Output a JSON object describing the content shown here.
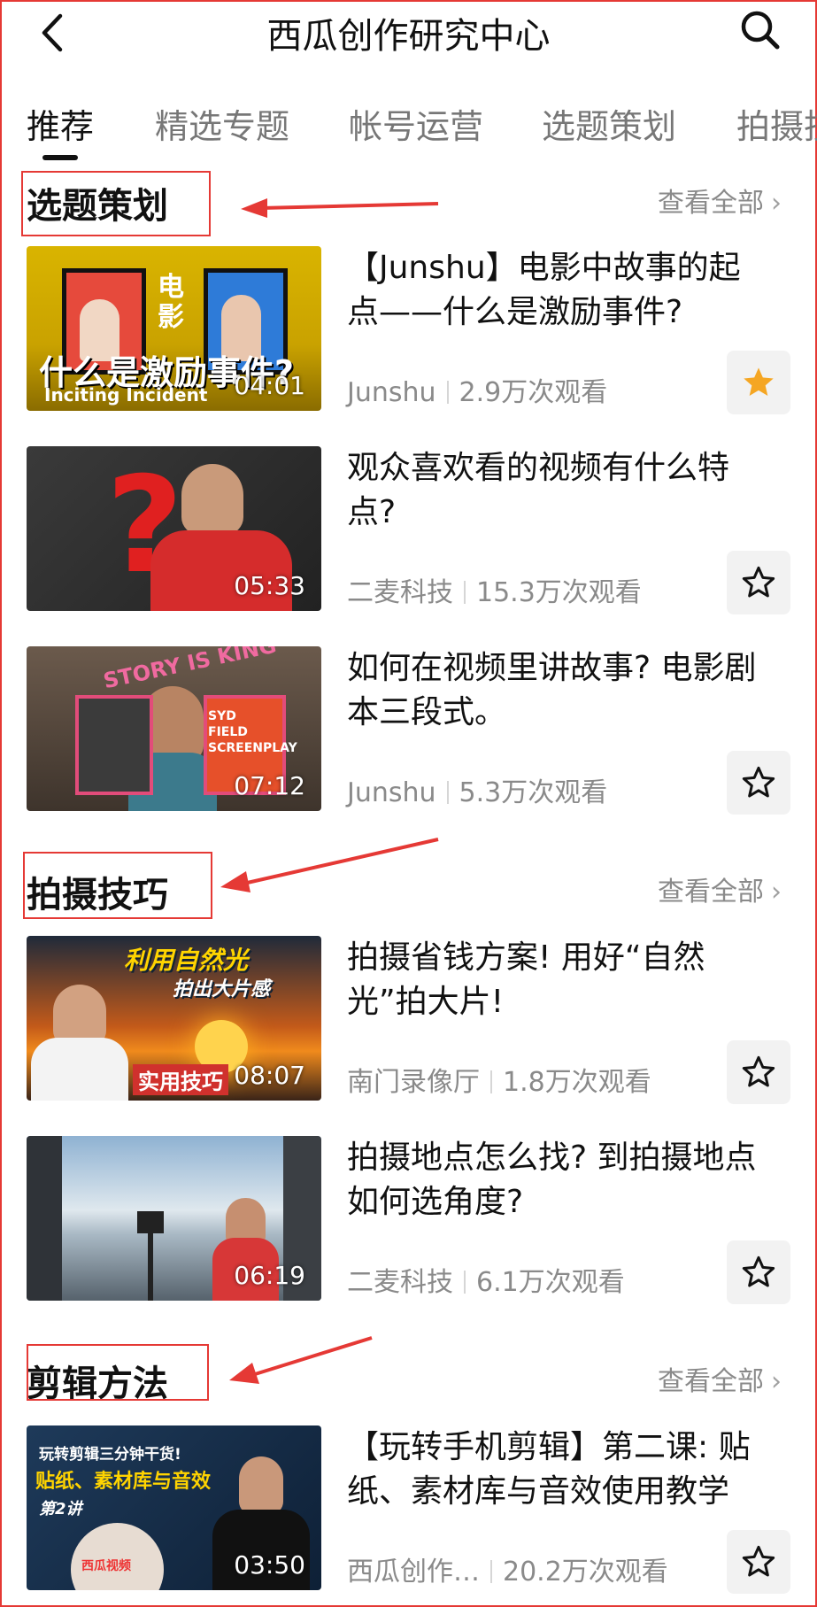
{
  "header": {
    "title": "西瓜创作研究中心",
    "back_icon": "chevron-left-icon",
    "search_icon": "search-icon"
  },
  "tabs": [
    {
      "label": "推荐",
      "active": true
    },
    {
      "label": "精选专题",
      "active": false
    },
    {
      "label": "帐号运营",
      "active": false
    },
    {
      "label": "选题策划",
      "active": false
    },
    {
      "label": "拍摄技巧",
      "active": false
    }
  ],
  "sections": [
    {
      "title": "选题策划",
      "see_all": "查看全部",
      "videos": [
        {
          "title": "【Junshu】电影中故事的起点——什么是激励事件?",
          "author": "Junshu",
          "views": "2.9万次观看",
          "duration": "04:01",
          "favorited": true,
          "thumb_text": "什么是激励事件?",
          "thumb_sub": "Inciting Incident",
          "thumb_side": "电影"
        },
        {
          "title": "观众喜欢看的视频有什么特点?",
          "author": "二麦科技",
          "views": "15.3万次观看",
          "duration": "05:33",
          "favorited": false,
          "thumb_text": "?"
        },
        {
          "title": "如何在视频里讲故事? 电影剧本三段式。",
          "author": "Junshu",
          "views": "5.3万次观看",
          "duration": "07:12",
          "favorited": false,
          "thumb_text": "STORY IS KING",
          "thumb_sub": "SYD FIELD SCREENPLAY"
        }
      ]
    },
    {
      "title": "拍摄技巧",
      "see_all": "查看全部",
      "videos": [
        {
          "title": "拍摄省钱方案! 用好“自然光”拍大片!",
          "author": "南门录像厅",
          "views": "1.8万次观看",
          "duration": "08:07",
          "favorited": false,
          "thumb_text": "利用自然光",
          "thumb_sub": "拍出大片感",
          "thumb_tag": "实用技巧"
        },
        {
          "title": "拍摄地点怎么找? 到拍摄地点如何选角度?",
          "author": "二麦科技",
          "views": "6.1万次观看",
          "duration": "06:19",
          "favorited": false
        }
      ]
    },
    {
      "title": "剪辑方法",
      "see_all": "查看全部",
      "videos": [
        {
          "title": "【玩转手机剪辑】第二课: 贴纸、素材库与音效使用教学",
          "author": "西瓜创作…",
          "views": "20.2万次观看",
          "duration": "03:50",
          "favorited": false,
          "thumb_text": "玩转剪辑三分钟干货!",
          "thumb_sub": "贴纸、素材库与音效",
          "thumb_tag": "第2讲",
          "thumb_logo": "西瓜视频"
        }
      ]
    }
  ],
  "colors": {
    "annotation": "#e53935",
    "star_active": "#f5a623",
    "muted": "#8a8a8a"
  }
}
